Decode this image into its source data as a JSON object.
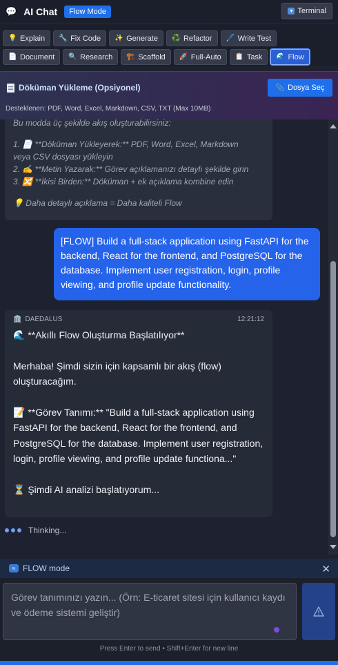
{
  "header": {
    "logo_glyph": "💬",
    "title": "AI Chat",
    "mode_badge": "Flow Mode",
    "terminal_label": "Terminal"
  },
  "toolbar": {
    "row1": [
      {
        "icon": "💡",
        "label": "Explain"
      },
      {
        "icon": "🔧",
        "label": "Fix Code"
      },
      {
        "icon": "✨",
        "label": "Generate"
      },
      {
        "icon": "♻️",
        "label": "Refactor"
      },
      {
        "icon": "🖊️",
        "label": "Write Test"
      }
    ],
    "row2": [
      {
        "icon": "📄",
        "label": "Document"
      },
      {
        "icon": "🔍",
        "label": "Research"
      },
      {
        "icon": "🏗️",
        "label": "Scaffold"
      },
      {
        "icon": "🚀",
        "label": "Full-Auto"
      },
      {
        "icon": "📋",
        "label": "Task"
      },
      {
        "icon": "🌊",
        "label": "Flow",
        "active": true
      }
    ]
  },
  "upload": {
    "title": "Döküman Yükleme (Opsiyonel)",
    "button_label": "Dosya Seç",
    "supported": "Desteklenen: PDF, Word, Excel, Markdown, CSV, TXT (Max 10MB)"
  },
  "messages": {
    "previous": {
      "lines": [
        "Bu modda üç şekilde akış oluşturabilirsiniz:",
        "",
        "1. 📄 **Döküman Yükleyerek:** PDF, Word, Excel, Markdown",
        "veya CSV dosyası yükleyin",
        "2. ✍️ **Metin Yazarak:** Görev açıklamanızı detaylı şekilde girin",
        "3. 🔀 **İkisi Birden:** Döküman + ek açıklama kombine edin",
        "",
        "💡 Daha detaylı açıklama = Daha kaliteli Flow"
      ]
    },
    "user": {
      "text": "[FLOW] Build a full-stack application using FastAPI for the backend, React for the frontend, and PostgreSQL for the database. Implement user registration, login, profile viewing, and profile update functionality."
    },
    "ai": {
      "author": "DAEDALUS",
      "author_icon": "🏛️",
      "time": "12:21:12",
      "heading": "🌊 **Akıllı Flow Oluşturma Başlatılıyor**",
      "greeting": "Merhaba! Şimdi sizin için kapsamlı bir akış (flow) oluşturacağım.",
      "task": "📝 **Görev Tanımı:** \"Build a full-stack application using FastAPI for the backend, React for the frontend, and PostgreSQL for the database. Implement user registration, login, profile viewing, and profile update functiona...\"",
      "status": "⏳ Şimdi AI analizi başlatıyorum..."
    },
    "thinking": "Thinking..."
  },
  "modebar": {
    "label": "FLOW mode"
  },
  "input": {
    "placeholder": "Görev tanımınızı yazın... (Örn: E-ticaret sitesi için kullanıcı kaydı ve ödeme sistemi geliştir)",
    "hint": "Press Enter to send • Shift+Enter for new line"
  },
  "colors": {
    "accent": "#1f6feb",
    "user_bubble": "#2563eb",
    "background": "#1e2230"
  }
}
